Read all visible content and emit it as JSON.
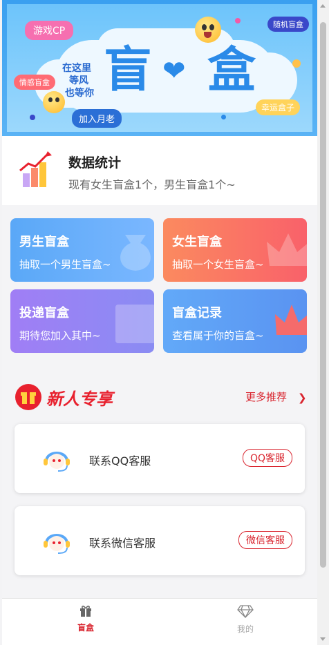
{
  "banner": {
    "char_left": "盲",
    "char_right": "盒",
    "tags": {
      "game_cp": "游戏CP",
      "random_box": "随机盲盒",
      "emotion_box": "情感盲盒",
      "join_matchmaker": "加入月老",
      "lucky_box": "幸运盒子"
    },
    "scribble": [
      "在这里",
      "等风",
      "也等你"
    ],
    "pager": {
      "count": 3,
      "active_index": 1
    }
  },
  "stats": {
    "title": "数据统计",
    "subtitle": "现有女生盲盒1个，男生盲盒1个~"
  },
  "cards": {
    "boy": {
      "title": "男生盲盒",
      "subtitle": "抽取一个男生盲盒~"
    },
    "girl": {
      "title": "女生盲盒",
      "subtitle": "抽取一个女生盲盒~"
    },
    "deliver": {
      "title": "投递盲盒",
      "subtitle": "期待您加入其中~"
    },
    "record": {
      "title": "盲盒记录",
      "subtitle": "查看属于你的盲盒~"
    }
  },
  "section": {
    "title": "新人专享",
    "more_label": "更多推荐",
    "services": {
      "qq": {
        "label": "联系QQ客服",
        "button": "QQ客服"
      },
      "wechat": {
        "label": "联系微信客服",
        "button": "微信客服"
      }
    }
  },
  "tabbar": {
    "home": {
      "label": "盲盒",
      "icon": "gift-icon",
      "active": true
    },
    "mine": {
      "label": "我的",
      "icon": "diamond-icon",
      "active": false
    }
  },
  "colors": {
    "accent": "#d9242e",
    "banner_blue": "#2a8ae8"
  }
}
